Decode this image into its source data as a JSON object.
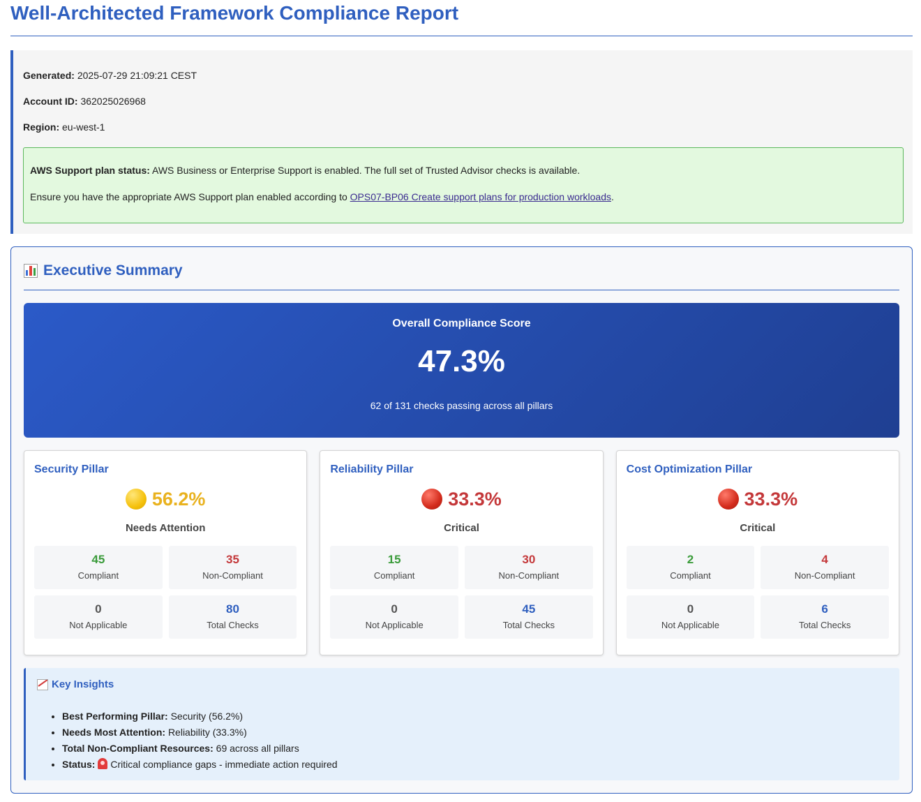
{
  "report": {
    "title": "Well-Architected Framework Compliance Report"
  },
  "info": {
    "generated_label": "Generated:",
    "generated_value": "2025-07-29 21:09:21 CEST",
    "account_label": "Account ID:",
    "account_value": "362025026968",
    "region_label": "Region:",
    "region_value": "eu-west-1"
  },
  "support": {
    "status_label": "AWS Support plan status:",
    "status_text": "AWS Business or Enterprise Support is enabled. The full set of Trusted Advisor checks is available.",
    "ensure_text": "Ensure you have the appropriate AWS Support plan enabled according to",
    "link_text": "OPS07-BP06 Create support plans for production workloads",
    "trailing": "."
  },
  "summary": {
    "title": "Executive Summary",
    "score_label": "Overall Compliance Score",
    "score_value": "47.3%",
    "score_sub": "62 of 131 checks passing across all pillars"
  },
  "pillars": [
    {
      "name": "Security Pillar",
      "score": "56.2%",
      "status": "Needs Attention",
      "compliant": "45",
      "non_compliant": "35",
      "not_applicable": "0",
      "total": "80"
    },
    {
      "name": "Reliability Pillar",
      "score": "33.3%",
      "status": "Critical",
      "compliant": "15",
      "non_compliant": "30",
      "not_applicable": "0",
      "total": "45"
    },
    {
      "name": "Cost Optimization Pillar",
      "score": "33.3%",
      "status": "Critical",
      "compliant": "2",
      "non_compliant": "4",
      "not_applicable": "0",
      "total": "6"
    }
  ],
  "stat_labels": {
    "compliant": "Compliant",
    "non_compliant": "Non-Compliant",
    "not_applicable": "Not Applicable",
    "total": "Total Checks"
  },
  "insights": {
    "title": "Key Insights",
    "items": [
      {
        "label": "Best Performing Pillar:",
        "text": "Security (56.2%)"
      },
      {
        "label": "Needs Most Attention:",
        "text": "Reliability (33.3%)"
      },
      {
        "label": "Total Non-Compliant Resources:",
        "text": "69 across all pillars"
      },
      {
        "label": "Status:",
        "text": "Critical compliance gaps - immediate action required"
      }
    ]
  },
  "colors": {
    "accent": "#2f5fbf",
    "compliant": "#3a9b3a",
    "non_compliant": "#c4383a",
    "warning": "#e9b21f"
  },
  "icons": {
    "summary": "bar-chart-icon",
    "insights": "trend-chart-icon",
    "status": "siren-icon",
    "pillar_security": "yellow-circle-icon",
    "pillar_reliability": "red-circle-icon",
    "pillar_cost": "red-circle-icon"
  }
}
